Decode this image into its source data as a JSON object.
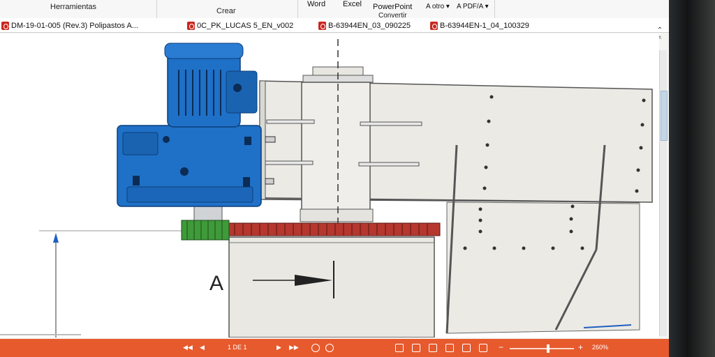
{
  "ribbon": {
    "groups": {
      "tools": "Herramientas",
      "create": "Crear",
      "convert": "Convertir"
    },
    "buttons": {
      "word": "Word",
      "excel": "Excel",
      "powerpoint": "PowerPoint",
      "other": "A otro ▾",
      "pdfa": "A PDF/A ▾"
    }
  },
  "tabs": [
    {
      "label": "DM-19-01-005 (Rev.3) Polipastos A..."
    },
    {
      "label": "0C_PK_LUCAS 5_EN_v002"
    },
    {
      "label": "B-63944EN_03_090225"
    },
    {
      "label": "B-63944EN-1_04_100329"
    }
  ],
  "drawing": {
    "section_label": "A"
  },
  "status": {
    "page": "1 DE 1",
    "zoom": "260%"
  },
  "colors": {
    "motor_blue": "#1f70c7",
    "gear_red": "#b5372e",
    "gear_green": "#3f9a3a",
    "status_orange": "#e65a2e",
    "frame_grey": "#ebeae5"
  },
  "zoom_fraction": 0.6
}
